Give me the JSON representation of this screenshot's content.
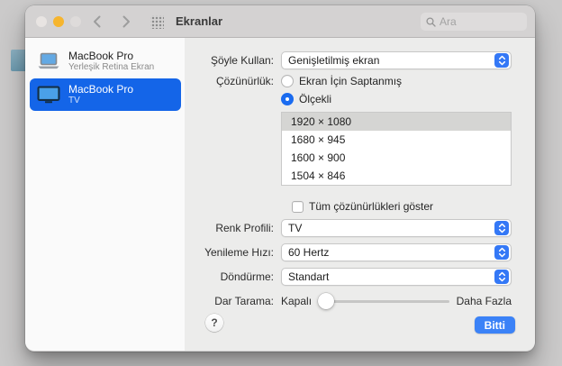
{
  "toolbar": {
    "title": "Ekranlar",
    "search_placeholder": "Ara"
  },
  "window_controls": {
    "close_color": "#e8e4e2",
    "minimize_color": "#f6b52e",
    "zoom_color": "#dedbda"
  },
  "sidebar": {
    "selection_color": "#1465e8",
    "items": [
      {
        "title": "MacBook Pro",
        "subtitle": "Yerleşik Retina Ekran",
        "icon": "laptop-icon",
        "selected": false
      },
      {
        "title": "MacBook Pro",
        "subtitle": "TV",
        "icon": "tv-icon",
        "selected": true
      }
    ]
  },
  "main": {
    "accent_color": "#3478f6",
    "use_as": {
      "label": "Şöyle Kullan:",
      "value": "Genişletilmiş ekran"
    },
    "resolution": {
      "label": "Çözünürlük:",
      "options": [
        {
          "label": "Ekran İçin Saptanmış",
          "selected": false
        },
        {
          "label": "Ölçekli",
          "selected": true
        }
      ],
      "list": [
        "1920 × 1080",
        "1680 × 945",
        "1600 × 900",
        "1504 × 846"
      ],
      "selected_index": 0
    },
    "show_all": {
      "label": "Tüm çözünürlükleri göster",
      "checked": false
    },
    "color_profile": {
      "label": "Renk Profili:",
      "value": "TV"
    },
    "refresh_rate": {
      "label": "Yenileme Hızı:",
      "value": "60 Hertz"
    },
    "rotation": {
      "label": "Döndürme:",
      "value": "Standart"
    },
    "underscan": {
      "label": "Dar Tarama:",
      "min_label": "Kapalı",
      "max_label": "Daha Fazla",
      "value": 0
    },
    "footer": {
      "help_label": "?",
      "done_label": "Bitti"
    }
  },
  "background": {
    "stray_help_label": "?"
  }
}
